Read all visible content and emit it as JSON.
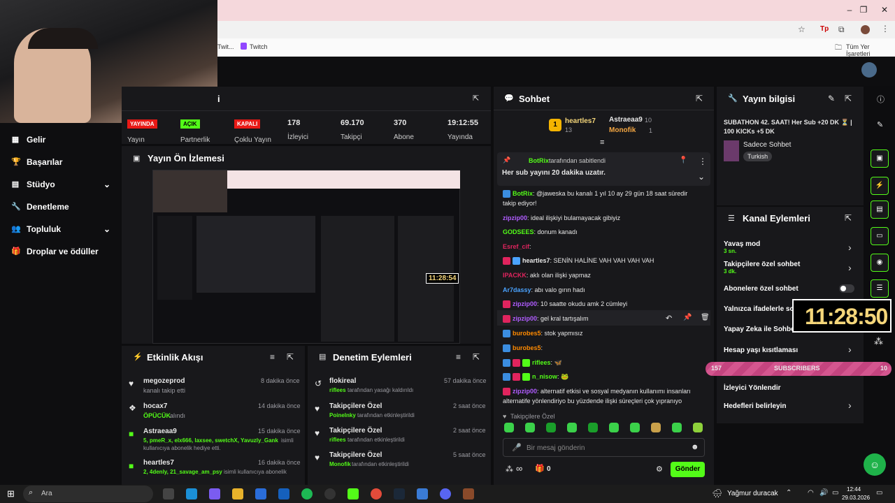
{
  "browser": {
    "bookmark_twitch": "Twitch",
    "bookmark_partial": "Twit...",
    "bookmarks_folder": "Tüm Yer İşaretleri"
  },
  "sidebar": {
    "items": [
      {
        "label": "Gelir",
        "icon": "chart-icon"
      },
      {
        "label": "Başarılar",
        "icon": "trophy-icon"
      },
      {
        "label": "Stüdyo",
        "icon": "layout-icon"
      },
      {
        "label": "Denetleme",
        "icon": "wrench-icon"
      },
      {
        "label": "Topluluk",
        "icon": "people-icon"
      },
      {
        "label": "Droplar ve ödüller",
        "icon": "gift-icon"
      }
    ]
  },
  "stats": {
    "title_partial": "i",
    "cells": [
      {
        "badge": "YAYINDA",
        "label": "Yayın"
      },
      {
        "badge": "AÇIK",
        "label": "Partnerlik"
      },
      {
        "badge": "KAPALI",
        "label": "Çoklu Yayın"
      },
      {
        "value": "178",
        "label": "İzleyici"
      },
      {
        "value": "69.170",
        "label": "Takipçi"
      },
      {
        "value": "370",
        "label": "Abone"
      },
      {
        "value": "19:12:55",
        "label": "Yayında"
      }
    ]
  },
  "preview": {
    "title": "Yayın Ön İzlemesi",
    "timer": "11:28:54"
  },
  "activity": {
    "title": "Etkinlik Akışı",
    "items": [
      {
        "user": "megozeprod",
        "time": "8 dakika önce",
        "desc": "kanalı takip etti",
        "highlight": ""
      },
      {
        "user": "hocax7",
        "time": "14 dakika önce",
        "desc": "alındı",
        "highlight": "ÖPÜCÜK"
      },
      {
        "user": "Astraeaa9",
        "time": "15 dakika önce",
        "highlight": "5, pmeR_x, elx666, laxsee, swetchX, Yavuzly_Gank",
        "desc": "isimli",
        "desc2": "kullanıcıya abonelik hediye etti."
      },
      {
        "user": "heartles7",
        "time": "16 dakika önce",
        "highlight": "2, 4denly, 21_savage_am_psy",
        "desc": "isimli kullanıcıya abonelik"
      }
    ]
  },
  "moderation": {
    "title": "Denetim Eylemleri",
    "items": [
      {
        "title": "flokireal",
        "time": "57 dakika önce",
        "actor": "riflees",
        "desc": "tarafından yasağı kaldırıldı"
      },
      {
        "title": "Takipçilere Özel",
        "time": "2 saat önce",
        "actor": "Poinelnky",
        "desc": "tarafından etkinleştirildi"
      },
      {
        "title": "Takipçilere Özel",
        "time": "2 saat önce",
        "actor": "riflees",
        "desc": "tarafından etkinleştirildi"
      },
      {
        "title": "Takipçilere Özel",
        "time": "5 saat önce",
        "actor": "Monofik",
        "desc": "tarafından etkinleştirildi"
      }
    ]
  },
  "chat": {
    "title": "Sohbet",
    "leaderboard": [
      {
        "rank": "1",
        "user": "heartles7",
        "count": "13"
      },
      {
        "user": "Astraeaa9",
        "count": "10"
      },
      {
        "user": "Monofik",
        "count": "1"
      }
    ],
    "pinned": {
      "by": "BotRix",
      "by_suffix": "tarafından sabitlendi",
      "message": "Her sub yayını 20 dakika uzatır."
    },
    "messages": [
      {
        "user": "BotRix",
        "color": "#53fc18",
        "text": "@jaweska bu kanalı 1 yıl 10 ay 29 gün 18 saat süredir"
      },
      {
        "user": "",
        "color": "#e8e8e8",
        "text": "takip ediyor!"
      },
      {
        "user": "zipzip00",
        "color": "#b05cff",
        "text": "ideal ilişkiyi bulamayacak gibiyiz"
      },
      {
        "user": "GODSEES",
        "color": "#53fc18",
        "text": "donum kanadı"
      },
      {
        "user": "Esref_cif",
        "color": "#e0245e",
        "text": ""
      },
      {
        "user": "heartles7",
        "color": "#e8e8e8",
        "text": "SENİN HALİNE VAH VAH VAH VAH"
      },
      {
        "user": "IPACKK",
        "color": "#e0245e",
        "text": "aklı olan ilişki yapmaz"
      },
      {
        "user": "Ar7dassy",
        "color": "#4aa3ff",
        "text": "abı valo gırın hadı"
      },
      {
        "user": "zipzip00",
        "color": "#b05cff",
        "text": "10 saatte okudu amk 2 cümleyi"
      },
      {
        "user": "zipzip00",
        "color": "#b05cff",
        "text": "gel kral tartışalım"
      },
      {
        "user": "burobes5",
        "color": "#ff8a00",
        "text": "stok yapmısız"
      },
      {
        "user": "burobes5",
        "color": "#ff8a00",
        "text": ""
      },
      {
        "user": "riflees",
        "color": "#53fc18",
        "text": ""
      },
      {
        "user": "n_nisow",
        "color": "#53fc18",
        "text": ""
      },
      {
        "user": "zipzip00",
        "color": "#b05cff",
        "text": "alternatif etkisi ve sosyal medyanın kullanımı insanları"
      },
      {
        "user": "",
        "color": "#e8e8e8",
        "text": "alternatife yönlendiriyo bu yüzdende ilişki süreçleri çok yıpranıyo"
      }
    ],
    "follower_mode": "Takipçilere Özel",
    "input_placeholder": "Bir mesaj gönderin",
    "infinity": "∞",
    "count": "0",
    "send": "Gönder"
  },
  "stream_info": {
    "title": "Yayın bilgisi",
    "stream_title": "SUBATHON 42. SAAT! Her Sub +20 DK ⏳ | 100 KICKs +5 DK",
    "category": "Sadece Sohbet",
    "tag": "Turkish"
  },
  "channel_actions": {
    "title": "Kanal Eylemleri",
    "items": [
      {
        "label": "Yavaş mod",
        "sub": "3 sn."
      },
      {
        "label": "Takipçilere özel sohbet",
        "sub": "3 dk."
      },
      {
        "label": "Abonelere özel sohbet",
        "sub": ""
      },
      {
        "label": "Yalnızca ifadelerle sohbet",
        "sub": ""
      },
      {
        "label": "Yapay Zeka ile Sohbet",
        "sub": ""
      },
      {
        "label": "Hesap yaşı kısıtlaması",
        "sub": ""
      },
      {
        "label": "İzleyici Yönlendir",
        "sub": ""
      },
      {
        "label": "Hedefleri belirleyin",
        "sub": ""
      }
    ]
  },
  "overlay": {
    "timer": "11:28:50",
    "sub_count": "157",
    "sub_label": "SUBSCRIBERS",
    "sub_goal": "10"
  },
  "taskbar": {
    "search": "Ara",
    "weather": "Yağmur duracak",
    "time": "12:44",
    "date": "29.03.2026"
  },
  "colors": {
    "accent": "#53fc18",
    "panel": "#18181b",
    "bg": "#0d0d0f",
    "live": "#e91916"
  }
}
